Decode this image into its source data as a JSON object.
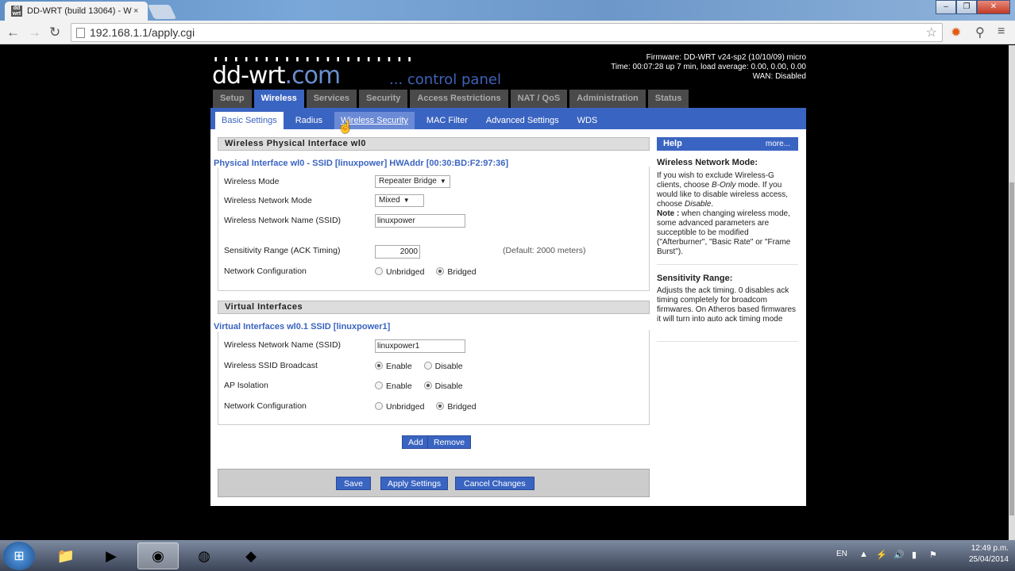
{
  "browser": {
    "tab_title": "DD-WRT (build 13064) - W",
    "tab_close": "×",
    "favicon_text": "dd wrt",
    "address": "192.168.1.1/apply.cgi",
    "back_icon": "arrow-left-icon",
    "forward_icon": "arrow-right-icon",
    "reload_icon": "reload-icon",
    "window_controls": [
      "‒",
      "❐",
      "✕"
    ]
  },
  "header": {
    "logo_dots": "▮ ▮ ▮ ▮ ▮ ▮ ▮ ▮ ▮ ▮ ▮ ▮ ▮ ▮ ▮ ▮ ▮ ▮ ▮ ▮",
    "logo_main": "dd-wrt",
    "logo_com": ".com",
    "control_panel": "... control panel",
    "firmware": "Firmware: DD-WRT v24-sp2 (10/10/09) micro",
    "time": "Time: 00:07:28 up 7 min, load average: 0.00, 0.00, 0.00",
    "wan": "WAN: Disabled"
  },
  "main_tabs": [
    {
      "label": "Setup",
      "active": false
    },
    {
      "label": "Wireless",
      "active": true
    },
    {
      "label": "Services",
      "active": false
    },
    {
      "label": "Security",
      "active": false
    },
    {
      "label": "Access Restrictions",
      "active": false
    },
    {
      "label": "NAT / QoS",
      "active": false
    },
    {
      "label": "Administration",
      "active": false
    },
    {
      "label": "Status",
      "active": false
    }
  ],
  "sub_tabs": [
    {
      "label": "Basic Settings",
      "active": true
    },
    {
      "label": "Radius",
      "active": false
    },
    {
      "label": "Wireless Security",
      "active": false
    },
    {
      "label": "MAC Filter",
      "active": false
    },
    {
      "label": "Advanced Settings",
      "active": false
    },
    {
      "label": "WDS",
      "active": false
    }
  ],
  "physical": {
    "section_title": "Wireless Physical Interface wl0",
    "legend": "Physical Interface wl0 - SSID [linuxpower] HWAddr [00:30:BD:F2:97:36]",
    "mode_label": "Wireless Mode",
    "mode_value": "Repeater Bridge",
    "netmode_label": "Wireless Network Mode",
    "netmode_value": "Mixed",
    "ssid_label": "Wireless Network Name (SSID)",
    "ssid_value": "linuxpower",
    "ack_label": "Sensitivity Range (ACK Timing)",
    "ack_value": "2000",
    "ack_default": "(Default: 2000 meters)",
    "netconf_label": "Network Configuration",
    "unbridged": "Unbridged",
    "bridged": "Bridged"
  },
  "virtual": {
    "section_title": "Virtual Interfaces",
    "legend": "Virtual Interfaces wl0.1 SSID [linuxpower1]",
    "ssid_label": "Wireless Network Name (SSID)",
    "ssid_value": "linuxpower1",
    "broadcast_label": "Wireless SSID Broadcast",
    "isolation_label": "AP Isolation",
    "enable": "Enable",
    "disable": "Disable",
    "netconf_label": "Network Configuration",
    "unbridged": "Unbridged",
    "bridged": "Bridged",
    "add": "Add",
    "remove": "Remove"
  },
  "footer": {
    "save": "Save",
    "apply": "Apply Settings",
    "cancel": "Cancel Changes"
  },
  "help": {
    "title": "Help",
    "more": "more...",
    "mode_title": "Wireless Network Mode:",
    "mode_text_1": "If you wish to exclude Wireless-G clients, choose ",
    "mode_text_b": "B-Only",
    "mode_text_2": " mode. If you would like to disable wireless access, choose ",
    "mode_text_d": "Disable",
    "mode_text_3": ".",
    "note_label": "Note :",
    "note_text": " when changing wireless mode, some advanced parameters are succeptible to be modified (\"Afterburner\", \"Basic Rate\" or \"Frame Burst\").",
    "sens_title": "Sensitivity Range:",
    "sens_text": "Adjusts the ack timing. 0 disables ack timing completely for broadcom firmwares. On Atheros based firmwares it will turn into auto ack timing mode"
  },
  "taskbar": {
    "lang": "EN",
    "time": "12:49 p.m.",
    "date": "25/04/2014"
  }
}
